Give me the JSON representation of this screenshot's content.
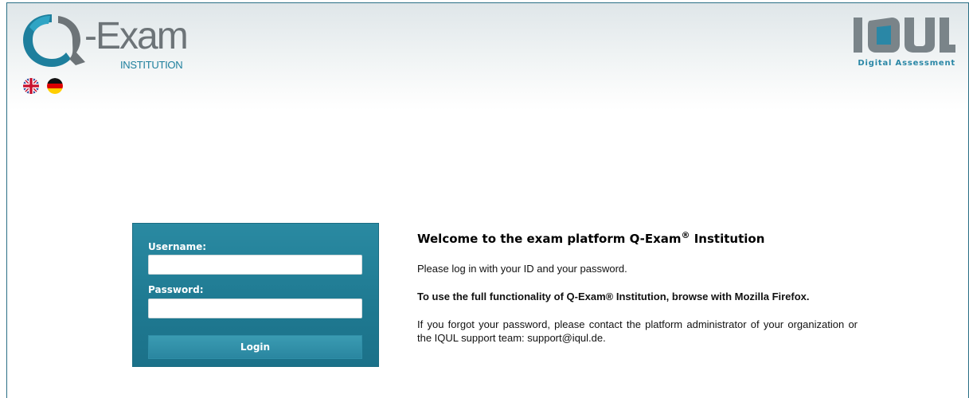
{
  "header": {
    "logo_left": {
      "text": "-Exam",
      "subtitle": "INSTITUTION"
    },
    "logo_right": {
      "text": "IQUL",
      "subtitle": "Digital Assessment"
    },
    "languages": [
      {
        "name": "English",
        "icon": "uk-flag-icon"
      },
      {
        "name": "German",
        "icon": "german-flag-icon"
      }
    ]
  },
  "login": {
    "username_label": "Username:",
    "username_value": "",
    "password_label": "Password:",
    "password_value": "",
    "button_label": "Login"
  },
  "welcome": {
    "title_prefix": "Welcome to the exam platform Q-Exam",
    "title_mark": "®",
    "title_suffix": " Institution",
    "line1": "Please log in with your ID and your password.",
    "line2": "To use the full functionality of Q-Exam® Institution, browse with Mozilla Firefox.",
    "line3": "If you forgot your password, please contact the platform administrator of your organization or the IQUL support team: support@iqul.de."
  },
  "colors": {
    "accent": "#1f7a92",
    "frame": "#2a6f85",
    "logo_blue": "#1e7f9d",
    "logo_grey": "#6d7478"
  }
}
